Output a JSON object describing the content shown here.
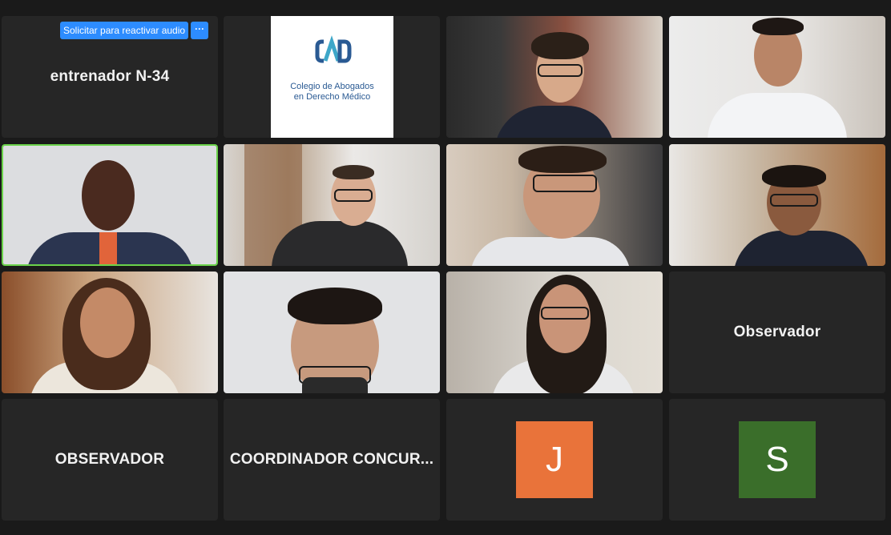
{
  "audio_prompt": {
    "label": "Solicitar para reactivar audio",
    "more_label": "···"
  },
  "logo": {
    "line1": "Colegio de Abogados",
    "line2": "en Derecho Médico"
  },
  "tiles": {
    "t1": {
      "name": "entrenador N-34"
    },
    "t12": {
      "name": "Observador"
    },
    "t13": {
      "name": "OBSERVADOR"
    },
    "t14": {
      "name": "COORDINADOR CONCUR..."
    },
    "t15": {
      "initial": "J",
      "color": "#e9733a"
    },
    "t16": {
      "initial": "S",
      "color": "#3a6e2a"
    }
  },
  "active_speaker_color": "#6ad24a",
  "accent_color": "#2d8cff"
}
